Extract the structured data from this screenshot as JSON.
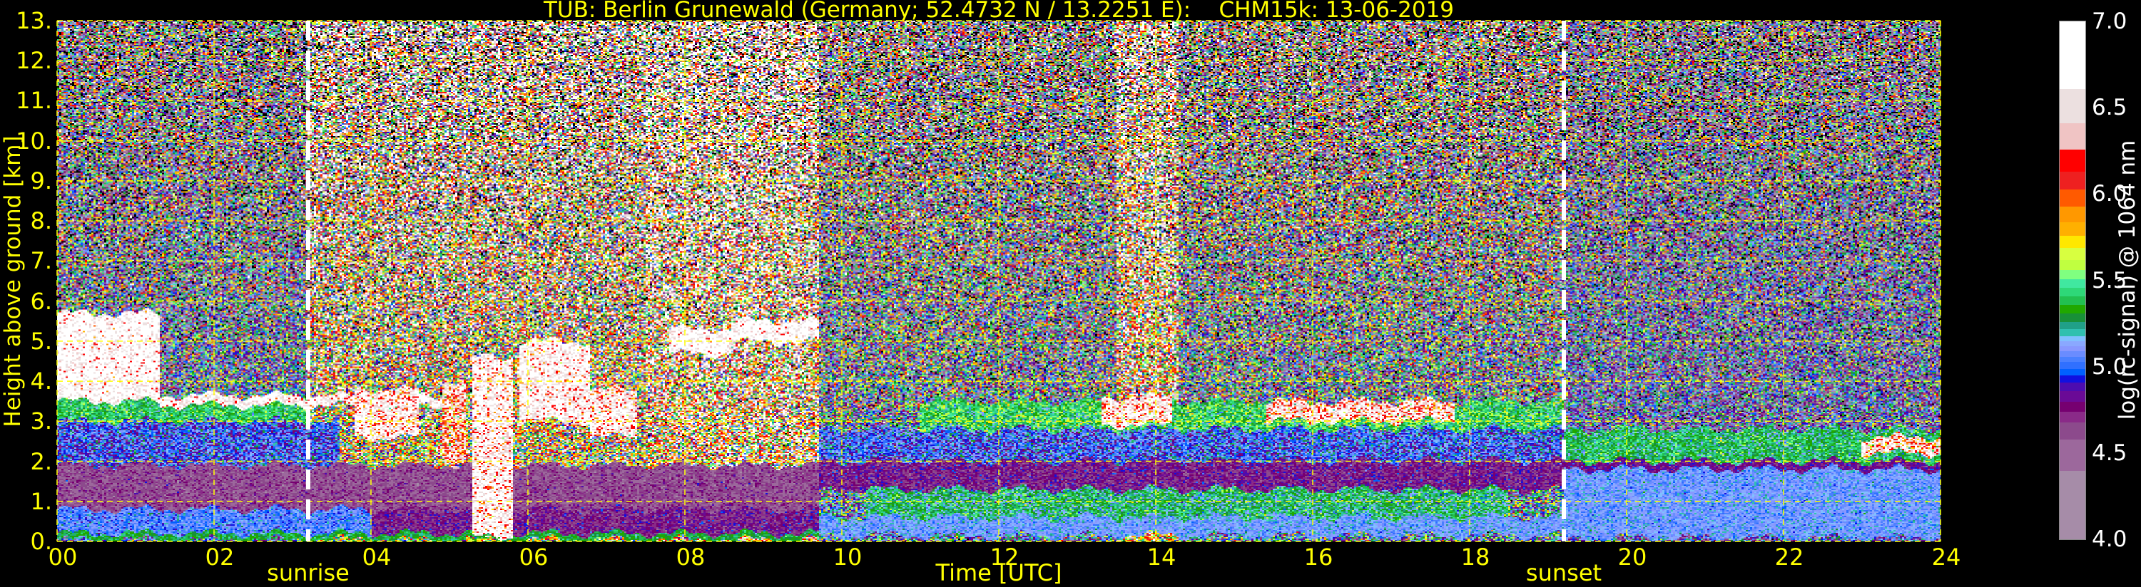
{
  "chart_data": {
    "type": "heatmap",
    "title": "TUB: Berlin Grunewald (Germany; 52.4732 N / 13.2251 E):    CHM15k: 13-06-2019",
    "xlabel": "Time [UTC]",
    "ylabel": "Height above ground [km]",
    "colorbar_label": "log(rc-signal) @ 1064 nm",
    "xlim": [
      0,
      24
    ],
    "ylim": [
      0,
      13
    ],
    "clim": [
      4.0,
      7.0
    ],
    "x_ticks": [
      0,
      2,
      4,
      6,
      8,
      10,
      12,
      14,
      16,
      18,
      20,
      22,
      24
    ],
    "x_tick_labels": [
      "00",
      "02",
      "04",
      "06",
      "08",
      "10",
      "12",
      "14",
      "16",
      "18",
      "20",
      "22",
      "24"
    ],
    "y_ticks": [
      0,
      1,
      2,
      3,
      4,
      5,
      6,
      7,
      8,
      9,
      10,
      11,
      12,
      13
    ],
    "y_tick_labels": [
      "0.",
      "1.",
      "2.",
      "3.",
      "4.",
      "5.",
      "6.",
      "7.",
      "8.",
      "9.",
      "10.",
      "11.",
      "12.",
      "13."
    ],
    "colorbar_ticks": [
      4.0,
      4.5,
      5.0,
      5.5,
      6.0,
      6.5,
      7.0
    ],
    "colorbar_tick_labels": [
      "4.0",
      "4.5",
      "5.0",
      "5.5",
      "6.0",
      "6.5",
      "7.0"
    ],
    "grid": true,
    "grid_color": "#ffff00",
    "text_color": "#ffff00",
    "events": [
      {
        "label": "sunrise",
        "time": 3.2
      },
      {
        "label": "sunset",
        "time": 19.2
      }
    ],
    "colormap": [
      [
        4.0,
        "#a68ca8"
      ],
      [
        4.4,
        "#9c689c"
      ],
      [
        4.58,
        "#8c4a8c"
      ],
      [
        4.68,
        "#8a2a88"
      ],
      [
        4.74,
        "#760070"
      ],
      [
        4.8,
        "#6a0a96"
      ],
      [
        4.86,
        "#4c0cb0"
      ],
      [
        4.91,
        "#1010e0"
      ],
      [
        4.95,
        "#0060ff"
      ],
      [
        4.99,
        "#3070ff"
      ],
      [
        5.03,
        "#4a80ff"
      ],
      [
        5.06,
        "#6a8cff"
      ],
      [
        5.09,
        "#8898ff"
      ],
      [
        5.12,
        "#8aa8ff"
      ],
      [
        5.15,
        "#80c0ff"
      ],
      [
        5.18,
        "#30c0b0"
      ],
      [
        5.22,
        "#20a088"
      ],
      [
        5.26,
        "#189038"
      ],
      [
        5.31,
        "#20a800"
      ],
      [
        5.36,
        "#22c050"
      ],
      [
        5.41,
        "#2ed878"
      ],
      [
        5.46,
        "#40e8a0"
      ],
      [
        5.51,
        "#80ff80"
      ],
      [
        5.56,
        "#c0ff40"
      ],
      [
        5.62,
        "#d8ff40"
      ],
      [
        5.69,
        "#ffe800"
      ],
      [
        5.76,
        "#ffb000"
      ],
      [
        5.84,
        "#ff9800"
      ],
      [
        5.93,
        "#ff5a00"
      ],
      [
        6.03,
        "#ee2020"
      ],
      [
        6.13,
        "#ff0000"
      ],
      [
        6.26,
        "#f0c4c4"
      ],
      [
        6.41,
        "#ece0e0"
      ],
      [
        6.61,
        "#ffffff"
      ]
    ],
    "background_noise": [
      {
        "t0": 0.0,
        "t1": 3.2,
        "mean": 5.0,
        "sigma": 0.55
      },
      {
        "t0": 3.2,
        "t1": 7.5,
        "mean": 5.6,
        "sigma": 0.8
      },
      {
        "t0": 7.5,
        "t1": 9.7,
        "mean": 5.9,
        "sigma": 0.9
      },
      {
        "t0": 9.7,
        "t1": 13.5,
        "mean": 5.1,
        "sigma": 0.6
      },
      {
        "t0": 13.5,
        "t1": 14.3,
        "mean": 5.8,
        "sigma": 0.8
      },
      {
        "t0": 14.3,
        "t1": 19.2,
        "mean": 5.1,
        "sigma": 0.6
      },
      {
        "t0": 19.2,
        "t1": 24.0,
        "mean": 4.9,
        "sigma": 0.5
      }
    ],
    "layers": [
      {
        "t0": 0.0,
        "t1": 3.6,
        "h0": 1.9,
        "h1": 3.0,
        "value": 5.0,
        "sigma": 0.15
      },
      {
        "t0": 0.0,
        "t1": 9.7,
        "h0": 0.8,
        "h1": 1.9,
        "value": 4.62,
        "sigma": 0.1
      },
      {
        "t0": 0.0,
        "t1": 4.0,
        "h0": 0.2,
        "h1": 0.8,
        "value": 5.06,
        "sigma": 0.08
      },
      {
        "t0": 4.0,
        "t1": 9.7,
        "h0": 0.2,
        "h1": 0.8,
        "value": 4.75,
        "sigma": 0.1
      },
      {
        "t0": 0.0,
        "t1": 9.7,
        "h0": 0.05,
        "h1": 0.2,
        "value": 5.33,
        "sigma": 0.06
      },
      {
        "t0": 0.0,
        "t1": 3.2,
        "h0": 3.0,
        "h1": 3.5,
        "value": 5.38,
        "sigma": 0.12
      },
      {
        "t0": 0.0,
        "t1": 1.3,
        "h0": 3.5,
        "h1": 5.7,
        "value": 6.8,
        "sigma": 0.3
      },
      {
        "t0": 1.3,
        "t1": 5.0,
        "h0": 3.4,
        "h1": 3.65,
        "value": 6.7,
        "sigma": 0.3
      },
      {
        "t0": 3.8,
        "t1": 4.6,
        "h0": 2.6,
        "h1": 3.8,
        "value": 6.6,
        "sigma": 0.4
      },
      {
        "t0": 4.9,
        "t1": 5.2,
        "h0": 2.0,
        "h1": 4.0,
        "value": 6.3,
        "sigma": 0.4
      },
      {
        "t0": 5.3,
        "t1": 5.8,
        "h0": 0.1,
        "h1": 4.6,
        "value": 6.7,
        "sigma": 0.4
      },
      {
        "t0": 5.9,
        "t1": 6.8,
        "h0": 3.0,
        "h1": 5.0,
        "value": 6.7,
        "sigma": 0.35
      },
      {
        "t0": 6.8,
        "t1": 7.4,
        "h0": 2.6,
        "h1": 3.8,
        "value": 6.6,
        "sigma": 0.4
      },
      {
        "t0": 7.8,
        "t1": 8.6,
        "h0": 4.7,
        "h1": 5.3,
        "value": 6.8,
        "sigma": 0.3
      },
      {
        "t0": 8.6,
        "t1": 9.7,
        "h0": 5.0,
        "h1": 5.5,
        "value": 6.8,
        "sigma": 0.3
      },
      {
        "t0": 9.7,
        "t1": 19.2,
        "h0": 2.0,
        "h1": 2.8,
        "value": 5.02,
        "sigma": 0.15
      },
      {
        "t0": 9.7,
        "t1": 19.2,
        "h0": 1.3,
        "h1": 2.0,
        "value": 4.75,
        "sigma": 0.1
      },
      {
        "t0": 9.7,
        "t1": 19.2,
        "h0": 0.15,
        "h1": 0.6,
        "value": 5.11,
        "sigma": 0.06
      },
      {
        "t0": 10.3,
        "t1": 18.5,
        "h0": 0.6,
        "h1": 1.3,
        "value": 5.3,
        "sigma": 0.14
      },
      {
        "t0": 11.0,
        "t1": 19.2,
        "h0": 2.8,
        "h1": 3.5,
        "value": 5.4,
        "sigma": 0.15
      },
      {
        "t0": 13.3,
        "t1": 14.2,
        "h0": 2.9,
        "h1": 3.6,
        "value": 6.6,
        "sigma": 0.4
      },
      {
        "t0": 15.4,
        "t1": 17.8,
        "h0": 3.0,
        "h1": 3.5,
        "value": 6.5,
        "sigma": 0.4
      },
      {
        "t0": 19.2,
        "t1": 24.0,
        "h0": 2.0,
        "h1": 2.8,
        "value": 5.33,
        "sigma": 0.12
      },
      {
        "t0": 19.2,
        "t1": 24.0,
        "h0": 1.8,
        "h1": 2.0,
        "value": 4.8,
        "sigma": 0.08
      },
      {
        "t0": 19.2,
        "t1": 24.0,
        "h0": 0.1,
        "h1": 1.8,
        "value": 5.1,
        "sigma": 0.06
      },
      {
        "t0": 23.0,
        "t1": 24.0,
        "h0": 2.2,
        "h1": 2.6,
        "value": 6.4,
        "sigma": 0.4
      }
    ]
  }
}
